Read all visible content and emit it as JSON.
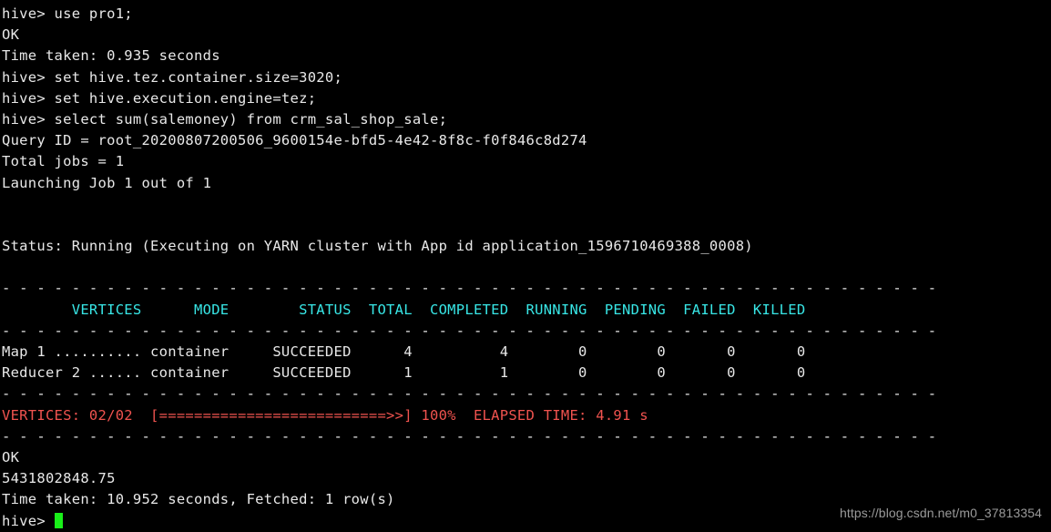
{
  "terminal": {
    "prompt": "hive> ",
    "cursor_color": "#19ef19",
    "foreground": "#e8e8e8",
    "background": "#000000",
    "header_color": "#38e6e6",
    "progress_color": "#f0534f",
    "lines": {
      "l01": "hive> use pro1;",
      "l02": "OK",
      "l03": "Time taken: 0.935 seconds",
      "l04": "hive> set hive.tez.container.size=3020;",
      "l05": "hive> set hive.execution.engine=tez;",
      "l06": "hive> select sum(salemoney) from crm_sal_shop_sale;",
      "l07": "Query ID = root_20200807200506_9600154e-bfd5-4e42-8f8c-f0f846c8d274",
      "l08": "Total jobs = 1",
      "l09": "Launching Job 1 out of 1",
      "l10": "",
      "l11": "",
      "l12": "Status: Running (Executing on YARN cluster with App id application_1596710469388_0008)",
      "l13": "",
      "sep1": "----------------------------------------------------------------------------------------------------------------",
      "header": "        VERTICES      MODE        STATUS  TOTAL  COMPLETED  RUNNING  PENDING  FAILED  KILLED",
      "sep2": "----------------------------------------------------------------------------------------------------------------",
      "row1": "Map 1 .......... container     SUCCEEDED      4          4        0        0       0       0",
      "row2": "Reducer 2 ...... container     SUCCEEDED      1          1        0        0       0       0",
      "sep3": "----------------------------------------------------------------------------------------------------------------",
      "progress": "VERTICES: 02/02  [==========================>>] 100%  ELAPSED TIME: 4.91 s",
      "sep4": "----------------------------------------------------------------------------------------------------------------",
      "l20": "OK",
      "l21": "5431802848.75",
      "l22": "Time taken: 10.952 seconds, Fetched: 1 row(s)",
      "l23": "hive> "
    },
    "table": {
      "columns": [
        "VERTICES",
        "MODE",
        "STATUS",
        "TOTAL",
        "COMPLETED",
        "RUNNING",
        "PENDING",
        "FAILED",
        "KILLED"
      ],
      "rows": [
        {
          "vertices": "Map 1 ..........",
          "mode": "container",
          "status": "SUCCEEDED",
          "total": "4",
          "completed": "4",
          "running": "0",
          "pending": "0",
          "failed": "0",
          "killed": "0"
        },
        {
          "vertices": "Reducer 2 ......",
          "mode": "container",
          "status": "SUCCEEDED",
          "total": "1",
          "completed": "1",
          "running": "0",
          "pending": "0",
          "failed": "0",
          "killed": "0"
        }
      ]
    },
    "summary": {
      "vertices_label": "VERTICES:",
      "vertices_count": "02/02",
      "bar": "[==========================>>]",
      "percent": "100%",
      "elapsed_label": "ELAPSED TIME:",
      "elapsed_value": "4.91 s"
    },
    "result": {
      "status": "OK",
      "value": "5431802848.75",
      "timing": "Time taken: 10.952 seconds, Fetched: 1 row(s)"
    }
  },
  "watermark": {
    "text": "https://blog.csdn.net/m0_37813354"
  }
}
